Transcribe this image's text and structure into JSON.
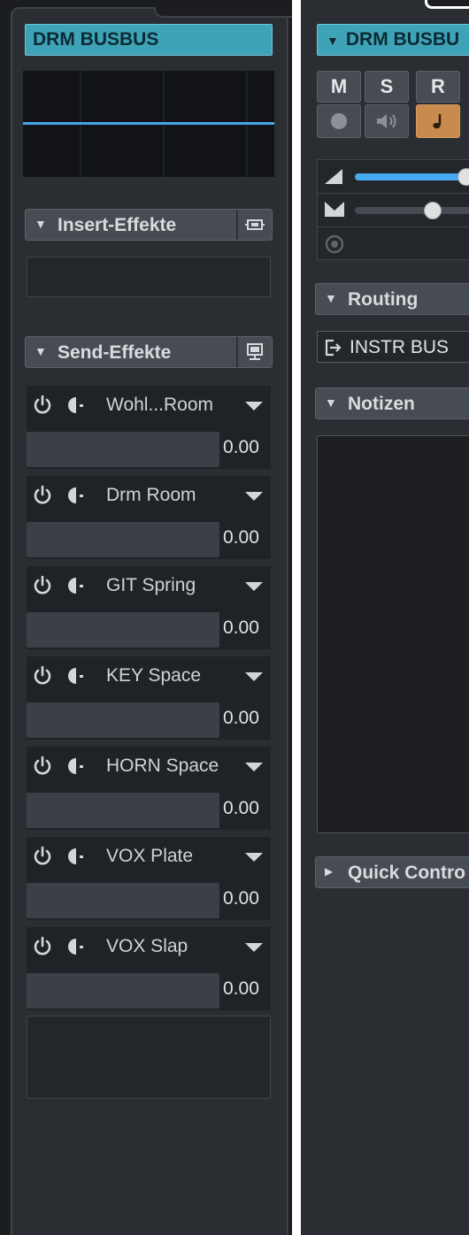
{
  "left_strip": {
    "channel_name": "DRM BUSBUS",
    "inserts": {
      "title": "Insert-Effekte"
    },
    "sends": {
      "title": "Send-Effekte",
      "slots": [
        {
          "name": "Wohl...Room",
          "level": "0.00"
        },
        {
          "name": "Drm Room",
          "level": "0.00"
        },
        {
          "name": "GIT Spring",
          "level": "0.00"
        },
        {
          "name": "KEY Space",
          "level": "0.00"
        },
        {
          "name": "HORN Space",
          "level": "0.00"
        },
        {
          "name": "VOX Plate",
          "level": "0.00"
        },
        {
          "name": "VOX Slap",
          "level": "0.00"
        }
      ]
    }
  },
  "inspector": {
    "channel_name": "DRM BUSBU",
    "buttons": {
      "mute": "M",
      "solo": "S",
      "read": "R"
    },
    "volume_level": 1.0,
    "pan_level": 0.5,
    "routing": {
      "title": "Routing",
      "output": "INSTR BUS"
    },
    "notes": {
      "title": "Notizen"
    },
    "quick_controls": {
      "title": "Quick Contro"
    }
  },
  "colors": {
    "accent_teal": "#3fa3b8",
    "meter_blue": "#43a6e8",
    "fader_blue": "#46aaf0",
    "monitor_orange": "#c98a4d"
  }
}
